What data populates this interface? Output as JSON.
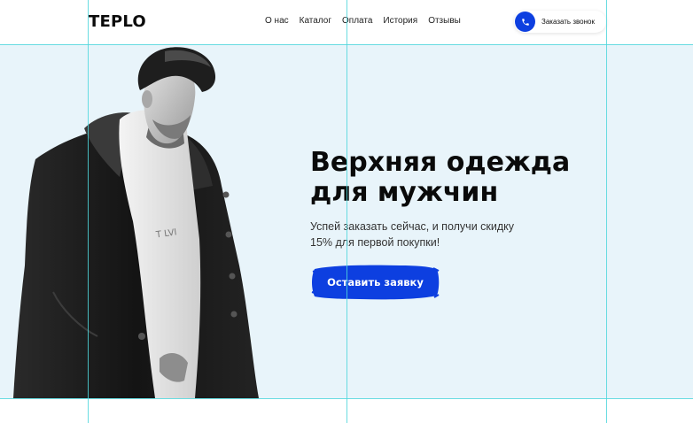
{
  "header": {
    "logo": "TEPLO",
    "nav": [
      "О нас",
      "Каталог",
      "Оплата",
      "История",
      "Отзывы"
    ],
    "call_label": "Заказать звонок"
  },
  "hero": {
    "title_line1": "Верхняя одежда",
    "title_line2": "для мужчин",
    "subtitle_line1": "Успей заказать сейчас, и получи скидку",
    "subtitle_line2": "15% для первой покупки!",
    "cta_label": "Оставить заявку"
  },
  "colors": {
    "accent": "#0d3fe0",
    "hero_bg": "#e8f4fa",
    "guide": "#4fd6dc"
  },
  "icons": {
    "phone": "phone-icon"
  }
}
